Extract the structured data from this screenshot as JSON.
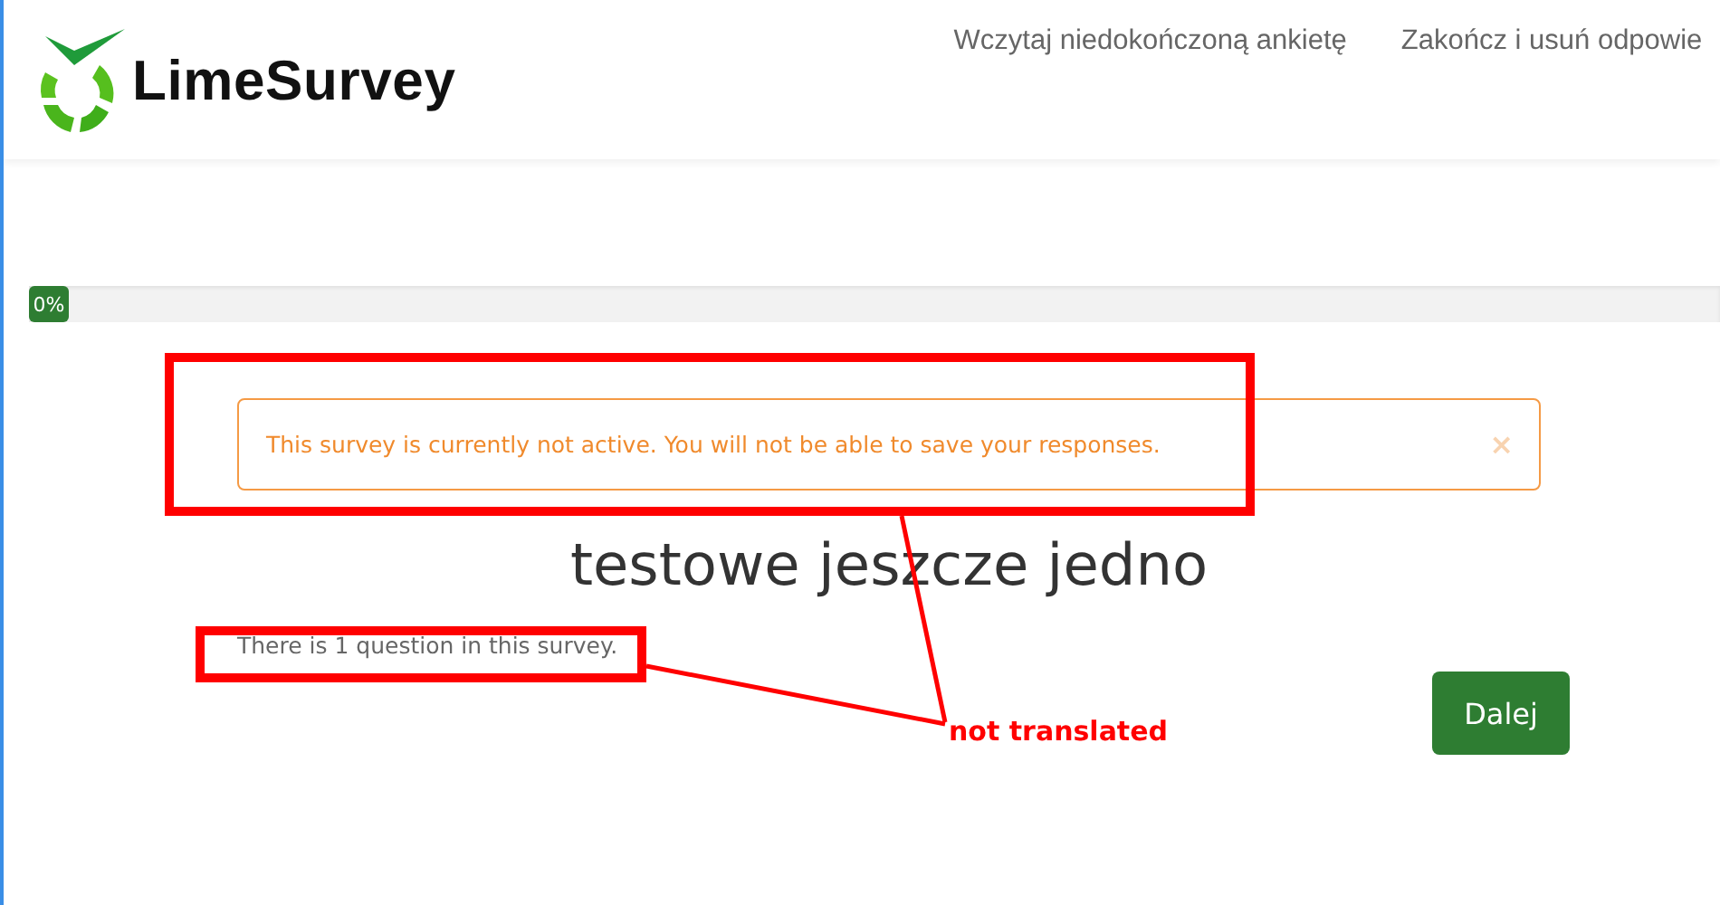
{
  "header": {
    "logo_text": "LimeSurvey",
    "nav": [
      "Wczytaj niedokończoną ankietę",
      "Zakończ i usuń odpowie"
    ]
  },
  "progress": {
    "label": "0%",
    "level": 0
  },
  "alert": {
    "message": "This survey is currently not active. You will not be able to save your responses.",
    "close": "×"
  },
  "survey": {
    "title": "testowe jeszcze jedno",
    "description": "There is 1 question in this survey."
  },
  "buttons": [
    "Dalej"
  ],
  "annotation": {
    "note": "not translated"
  }
}
